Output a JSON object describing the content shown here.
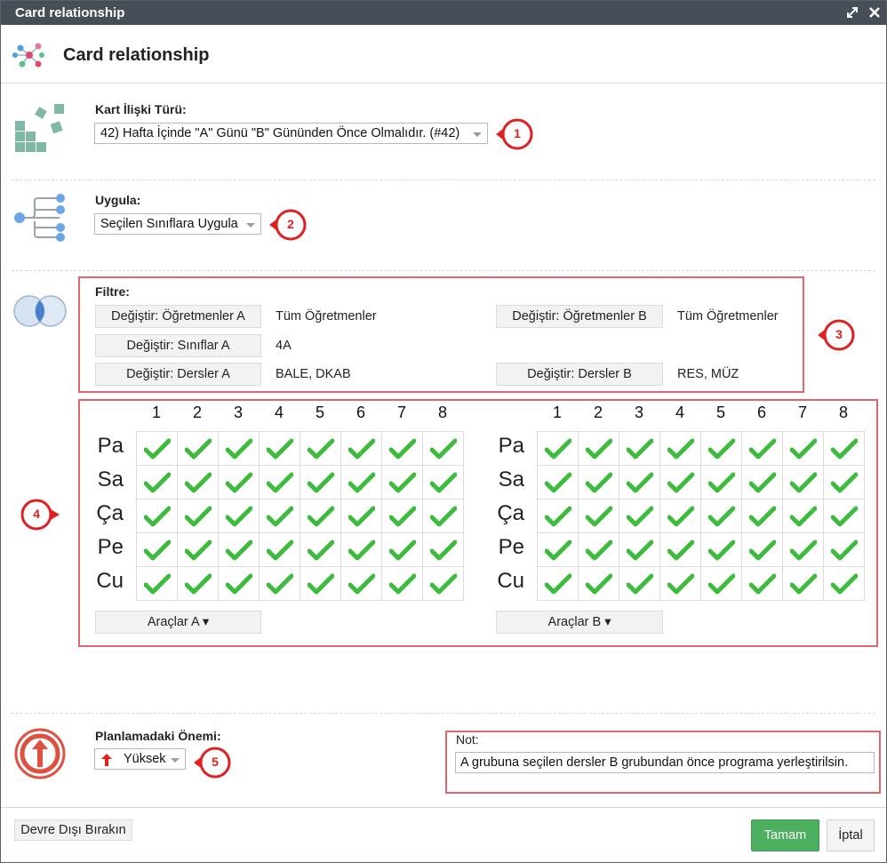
{
  "window": {
    "title": "Card relationship",
    "header_title": "Card relationship"
  },
  "relation_type": {
    "label": "Kart İlişki Türü:",
    "value": "42) Hafta İçinde \"A\" Günü \"B\" Gününden Önce Olmalıdır. (#42)"
  },
  "apply": {
    "label": "Uygula:",
    "value": "Seçilen Sınıflara Uygula"
  },
  "filter": {
    "label": "Filtre:",
    "teachers_a_button": "Değiştir: Öğretmenler A",
    "teachers_a_value": "Tüm Öğretmenler",
    "teachers_b_button": "Değiştir: Öğretmenler B",
    "teachers_b_value": "Tüm Öğretmenler",
    "classes_a_button": "Değiştir: Sınıflar A",
    "classes_a_value": "4A",
    "lessons_a_button": "Değiştir: Dersler A",
    "lessons_a_value": "BALE, DKAB",
    "lessons_b_button": "Değiştir: Dersler B",
    "lessons_b_value": "RES, MÜZ"
  },
  "grid": {
    "periods": [
      "1",
      "2",
      "3",
      "4",
      "5",
      "6",
      "7",
      "8"
    ],
    "days": [
      "Pa",
      "Sa",
      "Ça",
      "Pe",
      "Cu"
    ],
    "tools_a": "Araçlar A ▾",
    "tools_b": "Araçlar B ▾"
  },
  "importance": {
    "label": "Planlamadaki Önemi:",
    "value": "Yüksek"
  },
  "note": {
    "label": "Not:",
    "value": "A grubuna seçilen dersler B grubundan önce programa yerleştirilsin."
  },
  "badges": [
    "1",
    "2",
    "3",
    "4",
    "5"
  ],
  "footer": {
    "disable_button": "Devre Dışı Bırakın",
    "ok_button": "Tamam",
    "cancel_button": "İptal"
  },
  "icons": {
    "title_actions": [
      "maximize-icon",
      "close-icon"
    ],
    "sections": [
      "network-icon",
      "blocks-icon",
      "tree-icon",
      "venn-icon",
      "arrow-up-circle-icon"
    ],
    "cell_mark": "check-icon",
    "importance_mark": "red-up-arrow-icon"
  },
  "colors": {
    "titlebar": "#474e57",
    "accent_red": "#e02020",
    "check_green": "#3dbb3d",
    "ok_green": "#4cae5f",
    "highlight_box": "#e0686a"
  }
}
